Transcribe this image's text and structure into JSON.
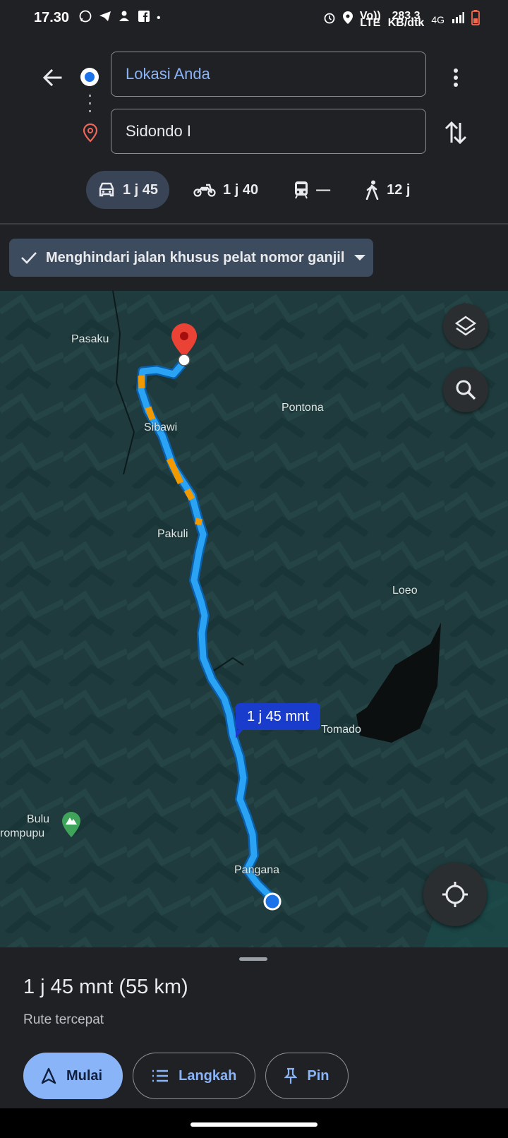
{
  "status_bar": {
    "time": "17.30",
    "speed_value": "283,3",
    "speed_unit": "KB/dtk",
    "volte_top": "Vo))",
    "volte_bottom": "LTE",
    "network": "4G"
  },
  "header": {
    "origin_value": "Lokasi Anda",
    "destination_value": "Sidondo I",
    "modes": [
      {
        "label": "1 j 45",
        "icon": "car-icon",
        "active": true
      },
      {
        "label": "1 j 40",
        "icon": "motorcycle-icon",
        "active": false
      },
      {
        "label": "—",
        "icon": "train-icon",
        "active": false
      },
      {
        "label": "12 j",
        "icon": "walk-icon",
        "active": false
      }
    ]
  },
  "filter_chip": {
    "label": "Menghindari jalan khusus pelat nomor ganjil"
  },
  "map": {
    "labels": {
      "pasaku": "Pasaku",
      "pontona": "Pontona",
      "sibawi": "Sibawi",
      "pakuli": "Pakuli",
      "loeo": "Loeo",
      "tomado": "Tomado",
      "bulu_1": "Bulu",
      "bulu_2": "rompupu",
      "pangana": "Pangana"
    },
    "duration_callout": "1 j 45 mnt",
    "route_color": "#2aa3f5",
    "traffic_color": "#f29900",
    "pin_color": "#ea4335"
  },
  "sheet": {
    "title": "1 j 45 mnt (55 km)",
    "subtitle": "Rute tercepat",
    "start_label": "Mulai",
    "steps_label": "Langkah",
    "pin_label": "Pin"
  },
  "colors": {
    "accent": "#8ab4f8",
    "background": "#202124"
  }
}
